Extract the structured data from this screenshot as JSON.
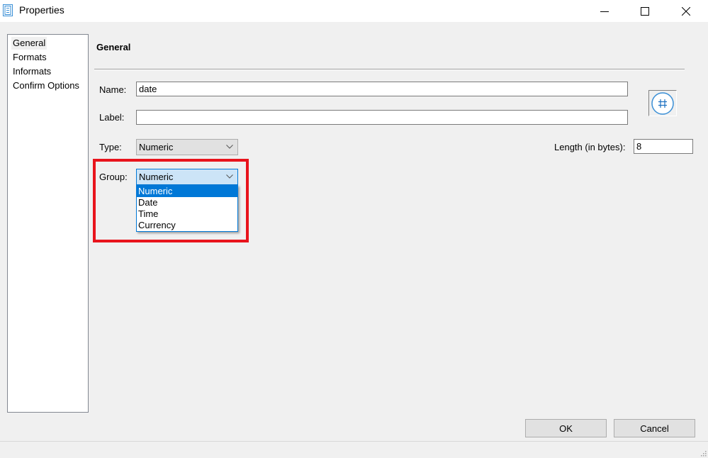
{
  "window": {
    "title": "Properties",
    "icon": "properties-icon",
    "controls": [
      "minimize-icon",
      "maximize-icon",
      "close-icon"
    ]
  },
  "nav": {
    "items": [
      {
        "label": "General",
        "selected": true
      },
      {
        "label": "Formats",
        "selected": false
      },
      {
        "label": "Informats",
        "selected": false
      },
      {
        "label": "Confirm Options",
        "selected": false
      }
    ]
  },
  "general": {
    "section_title": "General",
    "name_label": "Name:",
    "name_value": "date",
    "label_label": "Label:",
    "label_value": "",
    "type_label": "Type:",
    "type_value": "Numeric",
    "length_label": "Length (in bytes):",
    "length_value": "8",
    "group_label": "Group:",
    "group_value": "Numeric",
    "group_options": [
      "Numeric",
      "Date",
      "Time",
      "Currency"
    ],
    "group_highlighted": "Numeric",
    "type_icon": "numeric-hash-icon"
  },
  "buttons": {
    "ok": "OK",
    "cancel": "Cancel"
  },
  "colors": {
    "accent": "#0078d7",
    "highlight_border": "#e8141c"
  }
}
